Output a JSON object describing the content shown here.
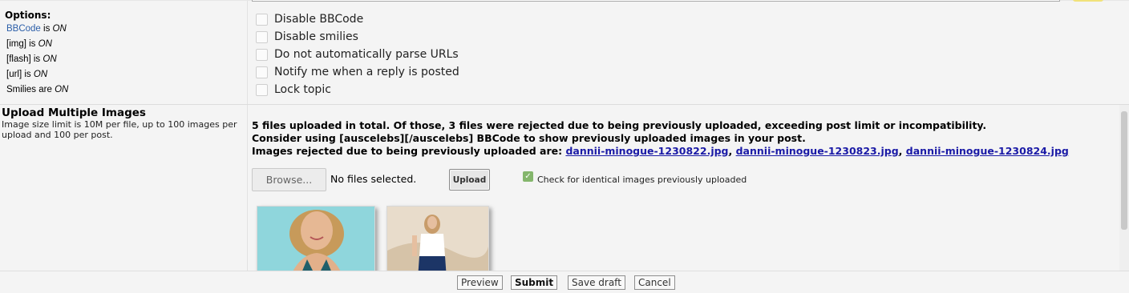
{
  "options": {
    "title": "Options:",
    "bbcode": {
      "link": "BBCode",
      "mid": " is ",
      "state": "ON"
    },
    "img": {
      "label": "[img] is ",
      "state": "ON"
    },
    "flash": {
      "label": "[flash] is ",
      "state": "ON"
    },
    "url": {
      "label": "[url] is ",
      "state": "ON"
    },
    "smilies": {
      "label": "Smilies are ",
      "state": "ON"
    },
    "checkboxes": [
      {
        "label": "Disable BBCode",
        "checked": false
      },
      {
        "label": "Disable smilies",
        "checked": false
      },
      {
        "label": "Do not automatically parse URLs",
        "checked": false
      },
      {
        "label": "Notify me when a reply is posted",
        "checked": false
      },
      {
        "label": "Lock topic",
        "checked": false
      }
    ]
  },
  "upload": {
    "title": "Upload Multiple Images",
    "desc": "Image size limit is 10M per file, up to 100 images per upload and 100 per post.",
    "msg1": "5 files uploaded in total. Of those, 3 files were rejected due to being previously uploaded, exceeding post limit or incompatibility.",
    "msg2": "Consider using [auscelebs][/auscelebs] BBCode to show previously uploaded images in your post.",
    "msg3_prefix": "Images rejected due to being previously uploaded are: ",
    "rejected": [
      "dannii-minogue-1230822.jpg",
      "dannii-minogue-1230823.jpg",
      "dannii-minogue-1230824.jpg"
    ],
    "sep": ", ",
    "browse_label": "Browse...",
    "no_files": "No files selected.",
    "upload_label": "Upload",
    "identical_label": "Check for identical images previously uploaded",
    "identical_checked": true
  },
  "footer": {
    "preview": "Preview",
    "submit": "Submit",
    "save_draft": "Save draft",
    "cancel": "Cancel"
  },
  "colors": {
    "link": "#1a1aa6",
    "accent_check": "#84b66c"
  }
}
